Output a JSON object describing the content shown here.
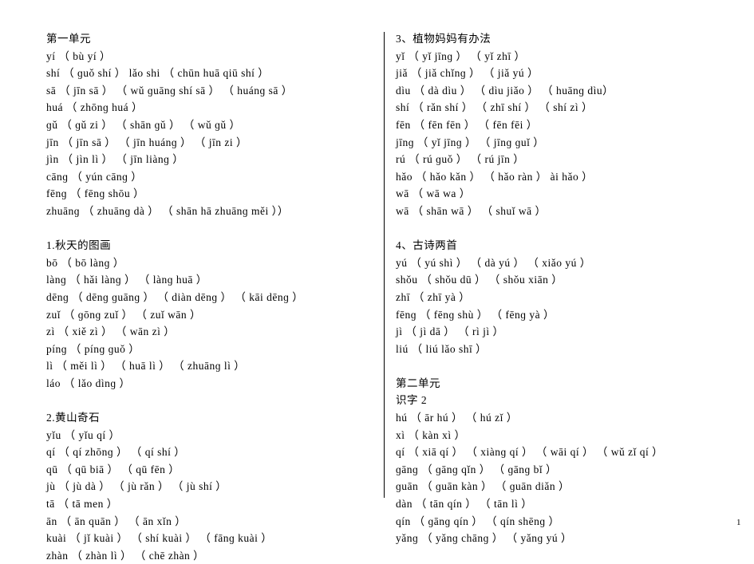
{
  "page_number": "1",
  "left": {
    "h1": "第一单元",
    "block1": [
      "yí （ bù yí ）",
      "shí （ ɡuǒ shí ） lǎo shi （ chūn huā qiū shí ）",
      "sā （ jīn sā ） （ wǔ ɡuānɡ shí sā ） （ huánɡ sā ）",
      "huá （ zhōnɡ huá ）",
      "ɡǔ （ ɡǔ zi ） （ shān ɡǔ ） （ wǔ ɡǔ ）",
      "jīn （ jīn sā ） （ jīn huánɡ ） （ jīn zi ）",
      "jìn （ jìn lì ） （ jīn liànɡ ）",
      "cānɡ （ yún cānɡ ）",
      "fēnɡ （ fēnɡ shōu ）",
      "zhuānɡ （ zhuānɡ dà ） （ shān hā zhuānɡ měi ））"
    ],
    "h2": "1.秋天的图画",
    "block2": [
      "bō （ bō lànɡ ）",
      "lànɡ （ hǎi lànɡ ） （ lànɡ huā ）",
      "dēnɡ （ dēnɡ ɡuānɡ ） （ diàn dēnɡ ） （ kāi dēnɡ ）",
      "zuǐ （ ɡōnɡ zuǐ ） （ zuǐ wān ）",
      "zì （ xiě zì ） （ wān zì ）",
      "pínɡ （ pínɡ ɡuǒ ）",
      "lì （ měi lì ） （ huā lì ） （ zhuānɡ lì ）",
      "láo （ lǎo dìnɡ ）"
    ],
    "h3": "2.黄山奇石",
    "block3": [
      "yǐu （ yǐu qí ）",
      "qí （ qí zhōnɡ ） （ qí shí ）",
      "qū （ qū biā ） （ qū fēn ）",
      "jù （ jù dà ） （ jù rǎn ） （ jù shí ）",
      "tā （ tā men ）",
      "ān （ ān quān ） （ ān xǐn ）",
      "kuài （ jǐ kuài ） （ shí kuài ） （ fānɡ kuài ）",
      "zhàn （ zhàn lì ） （ chē zhàn ）"
    ]
  },
  "right": {
    "h1": "3、植物妈妈有办法",
    "block1": [
      "yǐ （ yǐ jīnɡ ） （ yǐ zhī ）",
      "jiǎ （ jiǎ chǐnɡ ） （ jiǎ yú ）",
      "dìu （ dà dìu ） （ dìu jiǎo ） （ huānɡ dìu）",
      "shí （ rǎn shí ） （ zhī shí ） （ shí zì ）",
      "fēn （ fēn fēn ） （ fēn fēi ）",
      "jīnɡ （ yǐ jīnɡ ） （ jīnɡ ɡuǐ ）",
      "rú （ rú ɡuǒ ） （ rú jīn ）",
      "hǎo （ hǎo kǎn ） （ hǎo ràn ） ài hǎo ）",
      "wā （ wā wa ）",
      "wā （ shān wā ） （ shuǐ wā ）"
    ],
    "h2": "4、古诗两首",
    "block2": [
      "yú （ yú shì ） （ dà yú ） （ xiǎo yú ）",
      "shǒu （ shǒu dū ） （ shǒu xiān ）",
      "zhī （ zhī yà ）",
      "fēnɡ （ fēnɡ shù ） （ fēnɡ yà ）",
      "jì （ jì dā ） （ rì jì ）",
      "liú （ liú lǎo shī ）"
    ],
    "h3": "第二单元",
    "h4": "识字 2",
    "block3": [
      "hú （ ār hú ） （ hú zǐ ）",
      "xì （ kàn xì ）",
      "qí （ xiā qí ） （ xiànɡ qí ） （ wāi qí ） （ wǔ zǐ qí ）",
      "ɡānɡ （ ɡānɡ qǐn ） （ ɡānɡ bǐ ）",
      "ɡuān （ ɡuān kàn ） （ ɡuān diǎn ）",
      "dàn （ tān qín ） （ tān lì ）",
      "qín （ ɡānɡ qín ） （ qín shēnɡ ）",
      "yǎnɡ （ yǎnɡ chānɡ ） （ yǎnɡ yú ）"
    ]
  }
}
